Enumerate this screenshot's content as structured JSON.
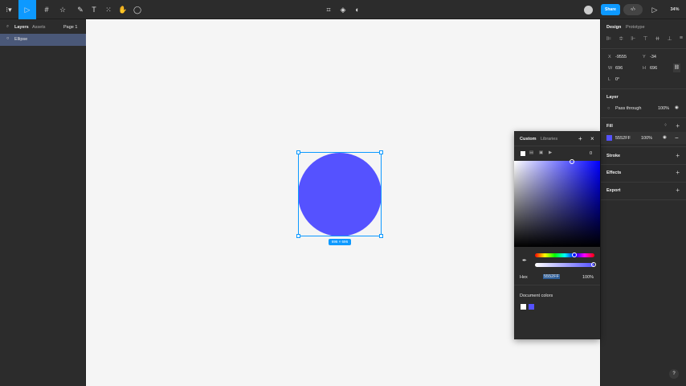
{
  "toolbar": {
    "share": "Share",
    "zoom": "34%",
    "tools": [
      "main-menu",
      "move",
      "frame",
      "shape",
      "pen",
      "text",
      "resources",
      "hand",
      "comment"
    ]
  },
  "left_panel": {
    "tabs": [
      "Layers",
      "Assets"
    ],
    "page": "Page 1",
    "layers": [
      {
        "name": "Ellipse",
        "selected": true
      }
    ]
  },
  "canvas": {
    "shape_color": "#5552FF",
    "dimension_label": "696 × 696"
  },
  "right_panel": {
    "tabs": [
      "Design",
      "Prototype"
    ],
    "x_label": "X",
    "x": "-9555",
    "y_label": "Y",
    "y": "-34",
    "w_label": "W",
    "w": "696",
    "h_label": "H",
    "h": "696",
    "rotation_label": "L",
    "rotation": "0°",
    "layer": {
      "title": "Layer",
      "blend": "Pass through",
      "opacity": "100%"
    },
    "fill": {
      "title": "Fill",
      "hex": "5552FF",
      "opacity": "100%",
      "color": "#5552FF"
    },
    "stroke": "Stroke",
    "effects": "Effects",
    "export": "Export"
  },
  "picker": {
    "tabs": [
      "Custom",
      "Libraries"
    ],
    "format": "Hex",
    "hex": "5552FF",
    "opacity": "100%",
    "alpha_count": "0",
    "doc_colors_title": "Document colors",
    "doc_colors": [
      "#FFFFFF",
      "#5552FF"
    ]
  },
  "help": "?"
}
